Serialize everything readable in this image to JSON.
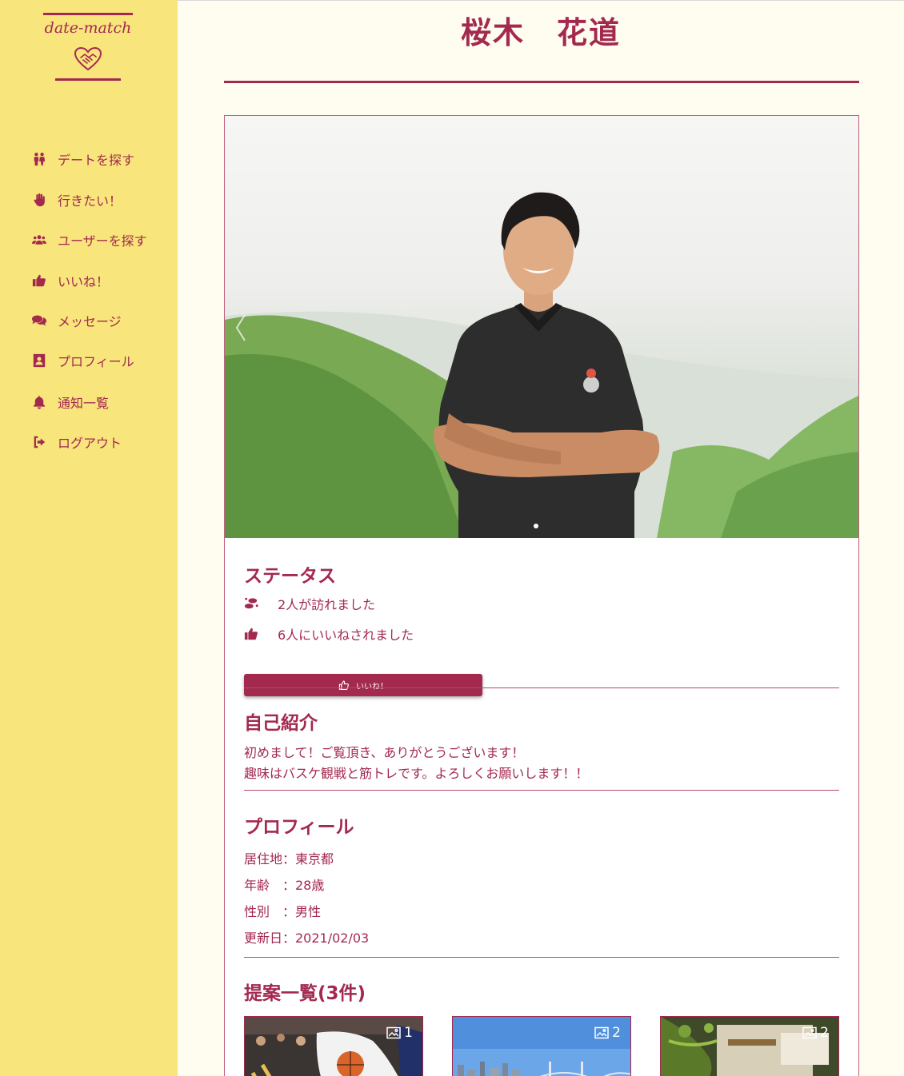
{
  "brand": {
    "name": "date-match"
  },
  "nav": {
    "items": [
      {
        "label": "デートを探す",
        "icon": "couple-icon"
      },
      {
        "label": "行きたい！",
        "icon": "hand-icon"
      },
      {
        "label": "ユーザーを探す",
        "icon": "users-icon"
      },
      {
        "label": "いいね！",
        "icon": "thumbs-up-icon"
      },
      {
        "label": "メッセージ",
        "icon": "comments-icon"
      },
      {
        "label": "プロフィール",
        "icon": "profile-card-icon"
      },
      {
        "label": "通知一覧",
        "icon": "bell-icon"
      },
      {
        "label": "ログアウト",
        "icon": "sign-out-icon"
      }
    ]
  },
  "profile": {
    "name": "桜木　花道",
    "carousel": {
      "slides": 1,
      "active": 0
    }
  },
  "status": {
    "title": "ステータス",
    "visits": "2人が訪れました",
    "likes": "6人にいいねされました",
    "like_button": "いいね！"
  },
  "intro": {
    "title": "自己紹介",
    "line1": "初めまして！ご覧頂き、ありがとうございます！",
    "line2": "趣味はバスケ観戦と筋トレです。よろしくお願いします！！"
  },
  "details": {
    "title": "プロフィール",
    "residence": "居住地：東京都",
    "age": "年齢　：28歳",
    "gender": "性別　：男性",
    "updated": "更新日：2021/02/03"
  },
  "proposals": {
    "title": "提案一覧(3件)",
    "items": [
      {
        "image_count": "1"
      },
      {
        "image_count": "2"
      },
      {
        "image_count": "2"
      }
    ]
  },
  "colors": {
    "accent": "#a3294f",
    "sidebar": "#f8e57c",
    "background": "#fefdf0"
  }
}
